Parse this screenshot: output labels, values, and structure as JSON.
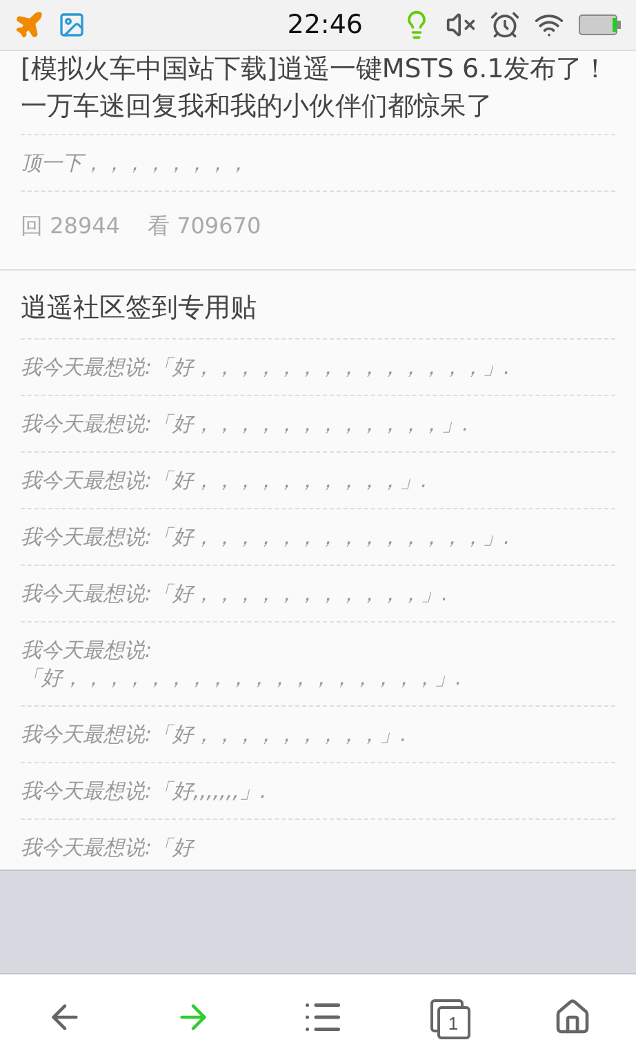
{
  "status_bar": {
    "time": "22:46"
  },
  "posts": [
    {
      "title": "[模拟火车中国站下载]逍遥一键MSTS 6.1发布了！一万车迷回复我和我的小伙伴们都惊呆了",
      "comments": [
        "顶一下，，，，，，，，"
      ],
      "replies": "回 28944",
      "views": "看 709670"
    },
    {
      "title": "逍遥社区签到专用贴",
      "comments": [
        "我今天最想说:「好，，，，，，，，，，，，，，」.",
        "我今天最想说:「好，，，，，，，，，，，，」.",
        "我今天最想说:「好，，，，，，，，，，」.",
        "我今天最想说:「好，，，，，，，，，，，，，，」.",
        "我今天最想说:「好，，，，，，，，，，，」.",
        "我今天最想说:\n「好，，，，，，，，，，，，，，，，，，」.",
        "我今天最想说:「好，，，，，，，，，」.",
        "我今天最想说:「好,,,,,,,」.",
        "我今天最想说:「好"
      ]
    }
  ],
  "nav": {
    "tab_count": "1",
    "forward_enabled": true
  }
}
